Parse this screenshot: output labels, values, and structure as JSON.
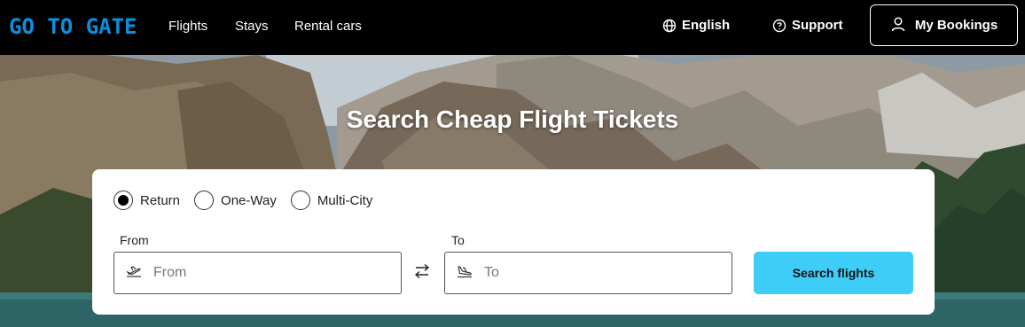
{
  "header": {
    "logo": "GO TO GATE",
    "nav": [
      "Flights",
      "Stays",
      "Rental cars"
    ],
    "language": "English",
    "support": "Support",
    "bookings": "My Bookings"
  },
  "hero": {
    "title": "Search Cheap Flight Tickets"
  },
  "search": {
    "trip_types": [
      {
        "label": "Return",
        "selected": true
      },
      {
        "label": "One-Way",
        "selected": false
      },
      {
        "label": "Multi-City",
        "selected": false
      }
    ],
    "from_label": "From",
    "from_placeholder": "From",
    "to_label": "To",
    "to_placeholder": "To",
    "submit": "Search flights"
  },
  "colors": {
    "logo": "#0a8fe0",
    "search_button": "#3ecdf7"
  }
}
